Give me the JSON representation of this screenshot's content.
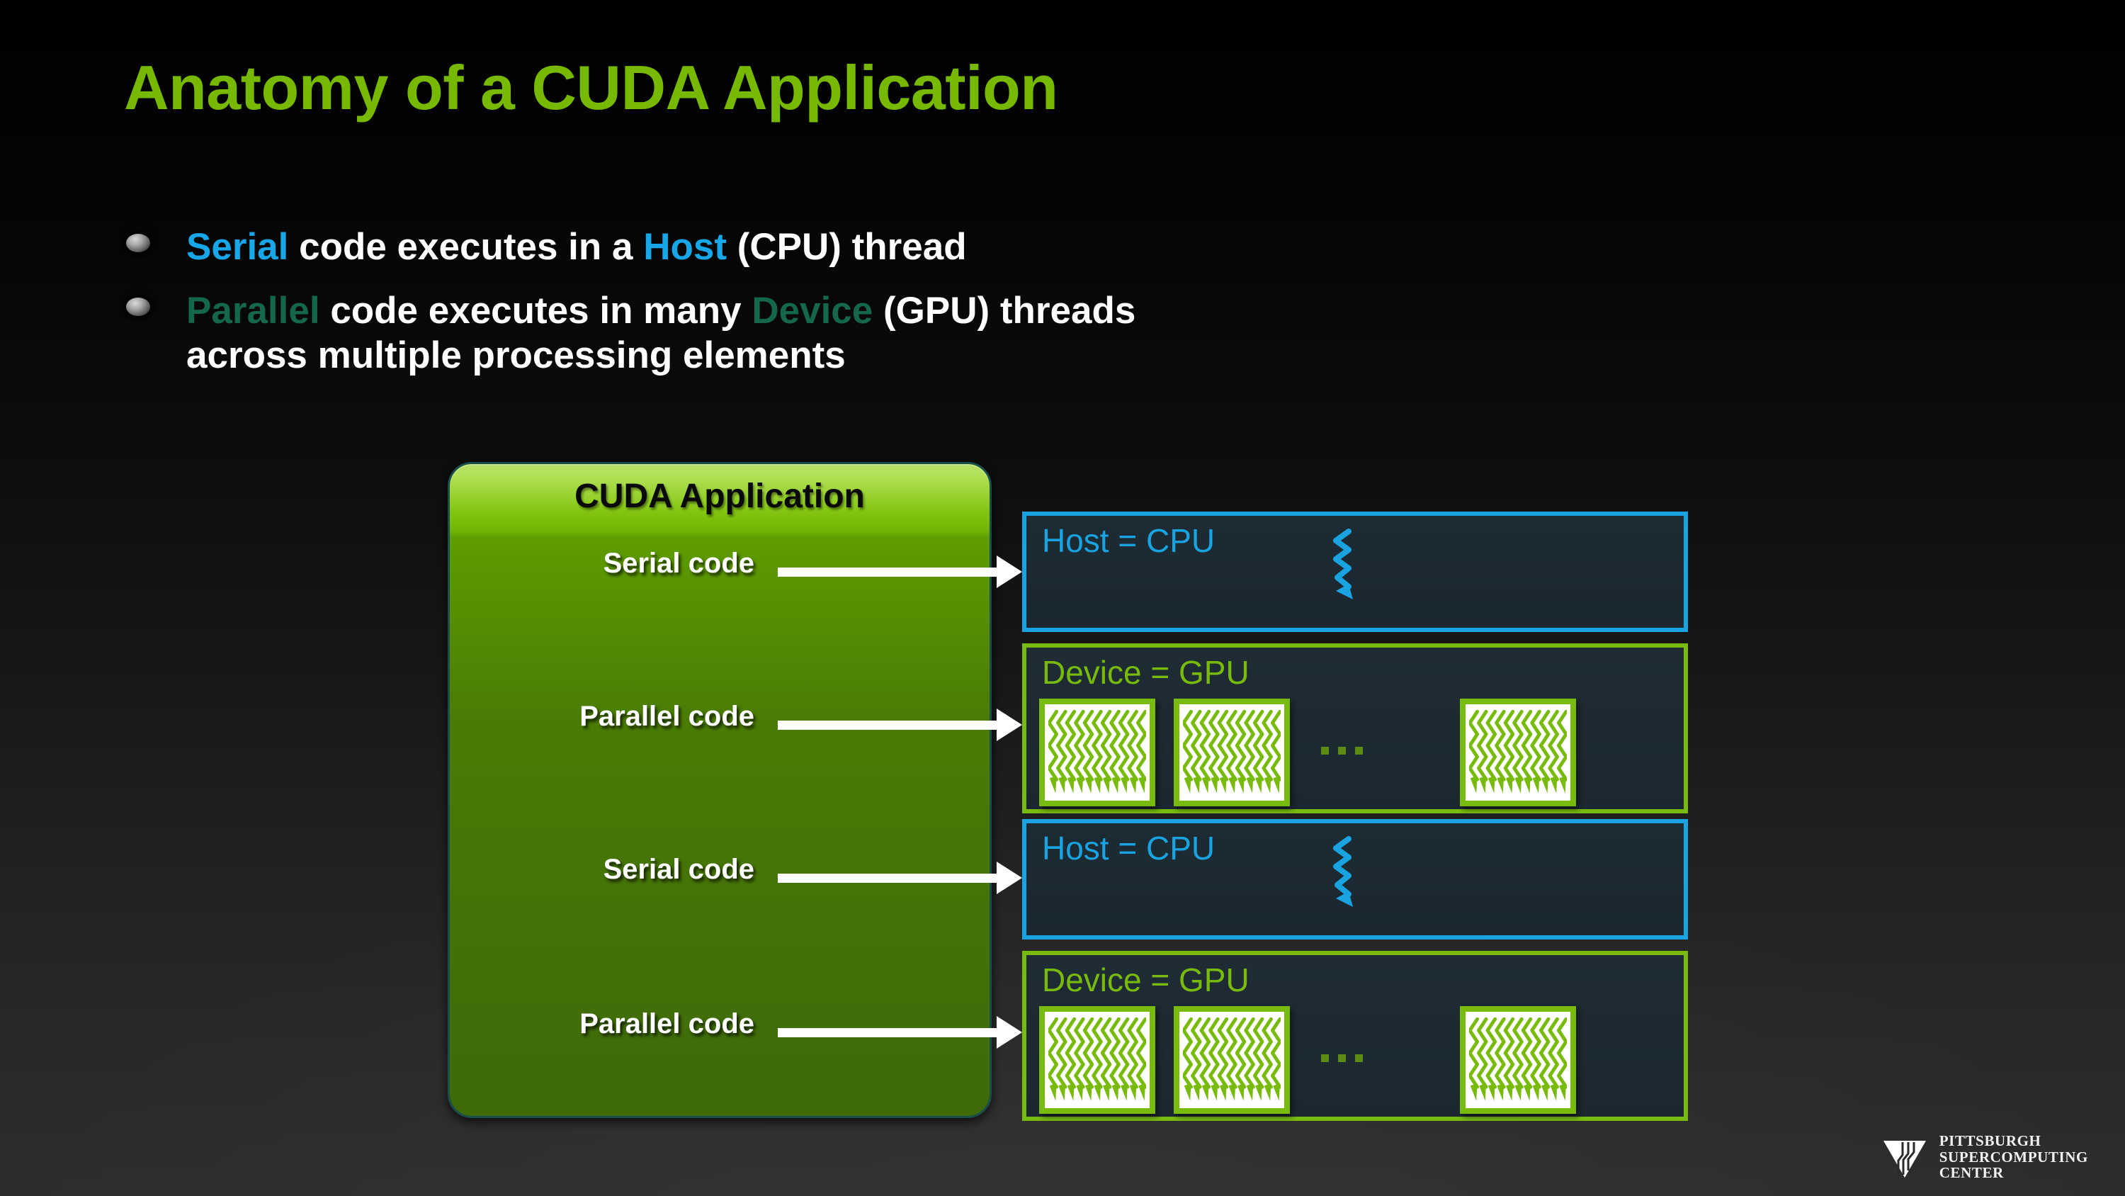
{
  "slide": {
    "title": "Anatomy of a CUDA Application",
    "title_color": "#76b900",
    "background_top": "#000000",
    "background_bottom": "#2d2d2d"
  },
  "bullets": [
    {
      "segments": [
        {
          "text": "Serial",
          "color": "#17a6e8"
        },
        {
          "text": " code executes in a ",
          "color": "#ffffff"
        },
        {
          "text": "Host",
          "color": "#17a6e8"
        },
        {
          "text": " (CPU) thread",
          "color": "#ffffff"
        }
      ]
    },
    {
      "segments": [
        {
          "text": "Parallel",
          "color": "#14664d"
        },
        {
          "text": " code executes in many ",
          "color": "#ffffff"
        },
        {
          "text": "Device",
          "color": "#14664d"
        },
        {
          "text": " (GPU) threads",
          "color": "#ffffff"
        }
      ],
      "line2": "across multiple processing elements"
    }
  ],
  "diagram": {
    "app_panel": {
      "title": "CUDA Application",
      "title_color": "#0a0a0a",
      "fill_top": "#7ec400",
      "fill_bottom": "#3e6a08",
      "steps": [
        {
          "label": "Serial code",
          "target": "host-cpu-1"
        },
        {
          "label": "Parallel code",
          "target": "device-gpu-1"
        },
        {
          "label": "Serial code",
          "target": "host-cpu-2"
        },
        {
          "label": "Parallel code",
          "target": "device-gpu-2"
        }
      ]
    },
    "hardware": [
      {
        "kind": "host",
        "label": "Host = CPU",
        "accent": "#19a3e0",
        "fill": "#1e2b33",
        "threads": 1
      },
      {
        "kind": "device",
        "label": "Device = GPU",
        "accent": "#79bb0d",
        "fill": "#1e2b33",
        "blocks": 3,
        "threads_per_block": 11,
        "ellipsis": "..."
      },
      {
        "kind": "host",
        "label": "Host = CPU",
        "accent": "#19a3e0",
        "fill": "#1e2b33",
        "threads": 1
      },
      {
        "kind": "device",
        "label": "Device = GPU",
        "accent": "#79bb0d",
        "fill": "#1e2b33",
        "blocks": 3,
        "threads_per_block": 11,
        "ellipsis": "..."
      }
    ],
    "arrow_color": "#ffffff",
    "cpu_thread_color": "#19a3e0",
    "gpu_thread_color": "#79bb0d"
  },
  "footer_logo": {
    "line1": "PITTSBURGH",
    "line2": "SUPERCOMPUTING",
    "line3": "CENTER",
    "icon": "psc-triangle-logo"
  }
}
